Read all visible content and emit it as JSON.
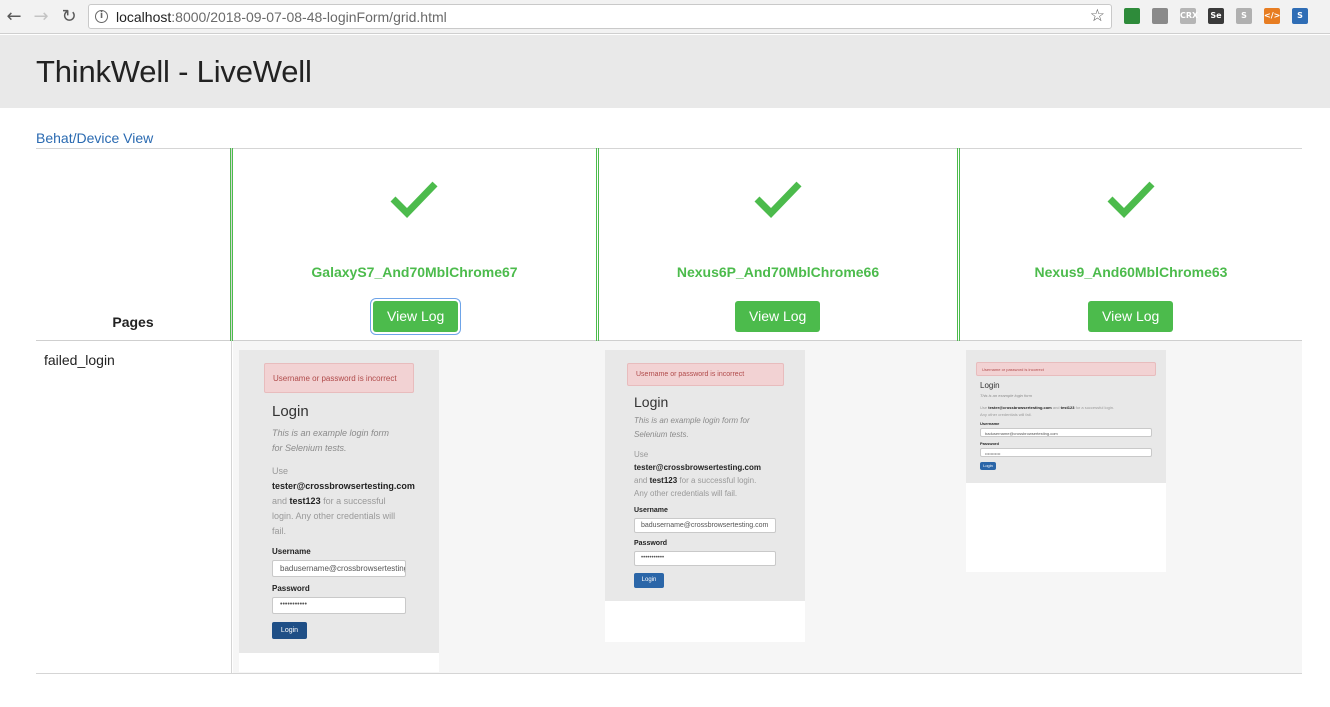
{
  "browser": {
    "url_host": "localhost",
    "url_rest": ":8000/2018-09-07-08-48-loginForm/grid.html",
    "back_icon": "arrow-left-icon",
    "forward_icon": "arrow-right-icon",
    "reload_icon": "reload-icon",
    "extensions": [
      {
        "name": "extension-green-icon",
        "color": "#2e8b3a",
        "label": ""
      },
      {
        "name": "extension-vue-icon",
        "color": "#8a8a8a",
        "label": ""
      },
      {
        "name": "extension-crx-icon",
        "color": "#b5b5b5",
        "label": "CRX"
      },
      {
        "name": "extension-selenium-icon",
        "color": "#3a3a3a",
        "label": "Se"
      },
      {
        "name": "extension-s-icon",
        "color": "#b0b0b0",
        "label": "S"
      },
      {
        "name": "extension-code-icon",
        "color": "#e77d22",
        "label": "</>"
      },
      {
        "name": "extension-s-blue-icon",
        "color": "#2f6db5",
        "label": "S"
      }
    ]
  },
  "header": {
    "title": "ThinkWell - LiveWell"
  },
  "nav": {
    "link": "Behat/Device View"
  },
  "grid": {
    "pages_heading": "Pages",
    "status_color": "#4cbb4c",
    "devices": [
      {
        "name": "GalaxyS7_And70MblChrome67",
        "status": "passed",
        "button": "View Log"
      },
      {
        "name": "Nexus6P_And70MblChrome66",
        "status": "passed",
        "button": "View Log"
      },
      {
        "name": "Nexus9_And60MblChrome63",
        "status": "passed",
        "button": "View Log"
      }
    ],
    "rows": [
      {
        "page": "failed_login"
      }
    ]
  },
  "screenshot": {
    "alert": "Username or password is incorrect",
    "heading": "Login",
    "desc1": "This is an example login form",
    "desc2": "for Selenium tests.",
    "desc_short1": "This is an example login form for",
    "desc_short2": "Selenium tests.",
    "use": "Use",
    "email": "tester@crossbrowsertesting.com",
    "and": "and",
    "password_hint": "test123",
    "for_success": "for a successful",
    "tail1": "login. Any other credentials will",
    "tail2": "fail.",
    "for_success_long": "for a successful login.",
    "tail_long": "Any other credentials will fail.",
    "username_label": "Username",
    "username_value": "badusername@crossbrowsertesting.com",
    "password_label": "Password",
    "password_value": "•••••••••••",
    "login_button": "Login"
  }
}
